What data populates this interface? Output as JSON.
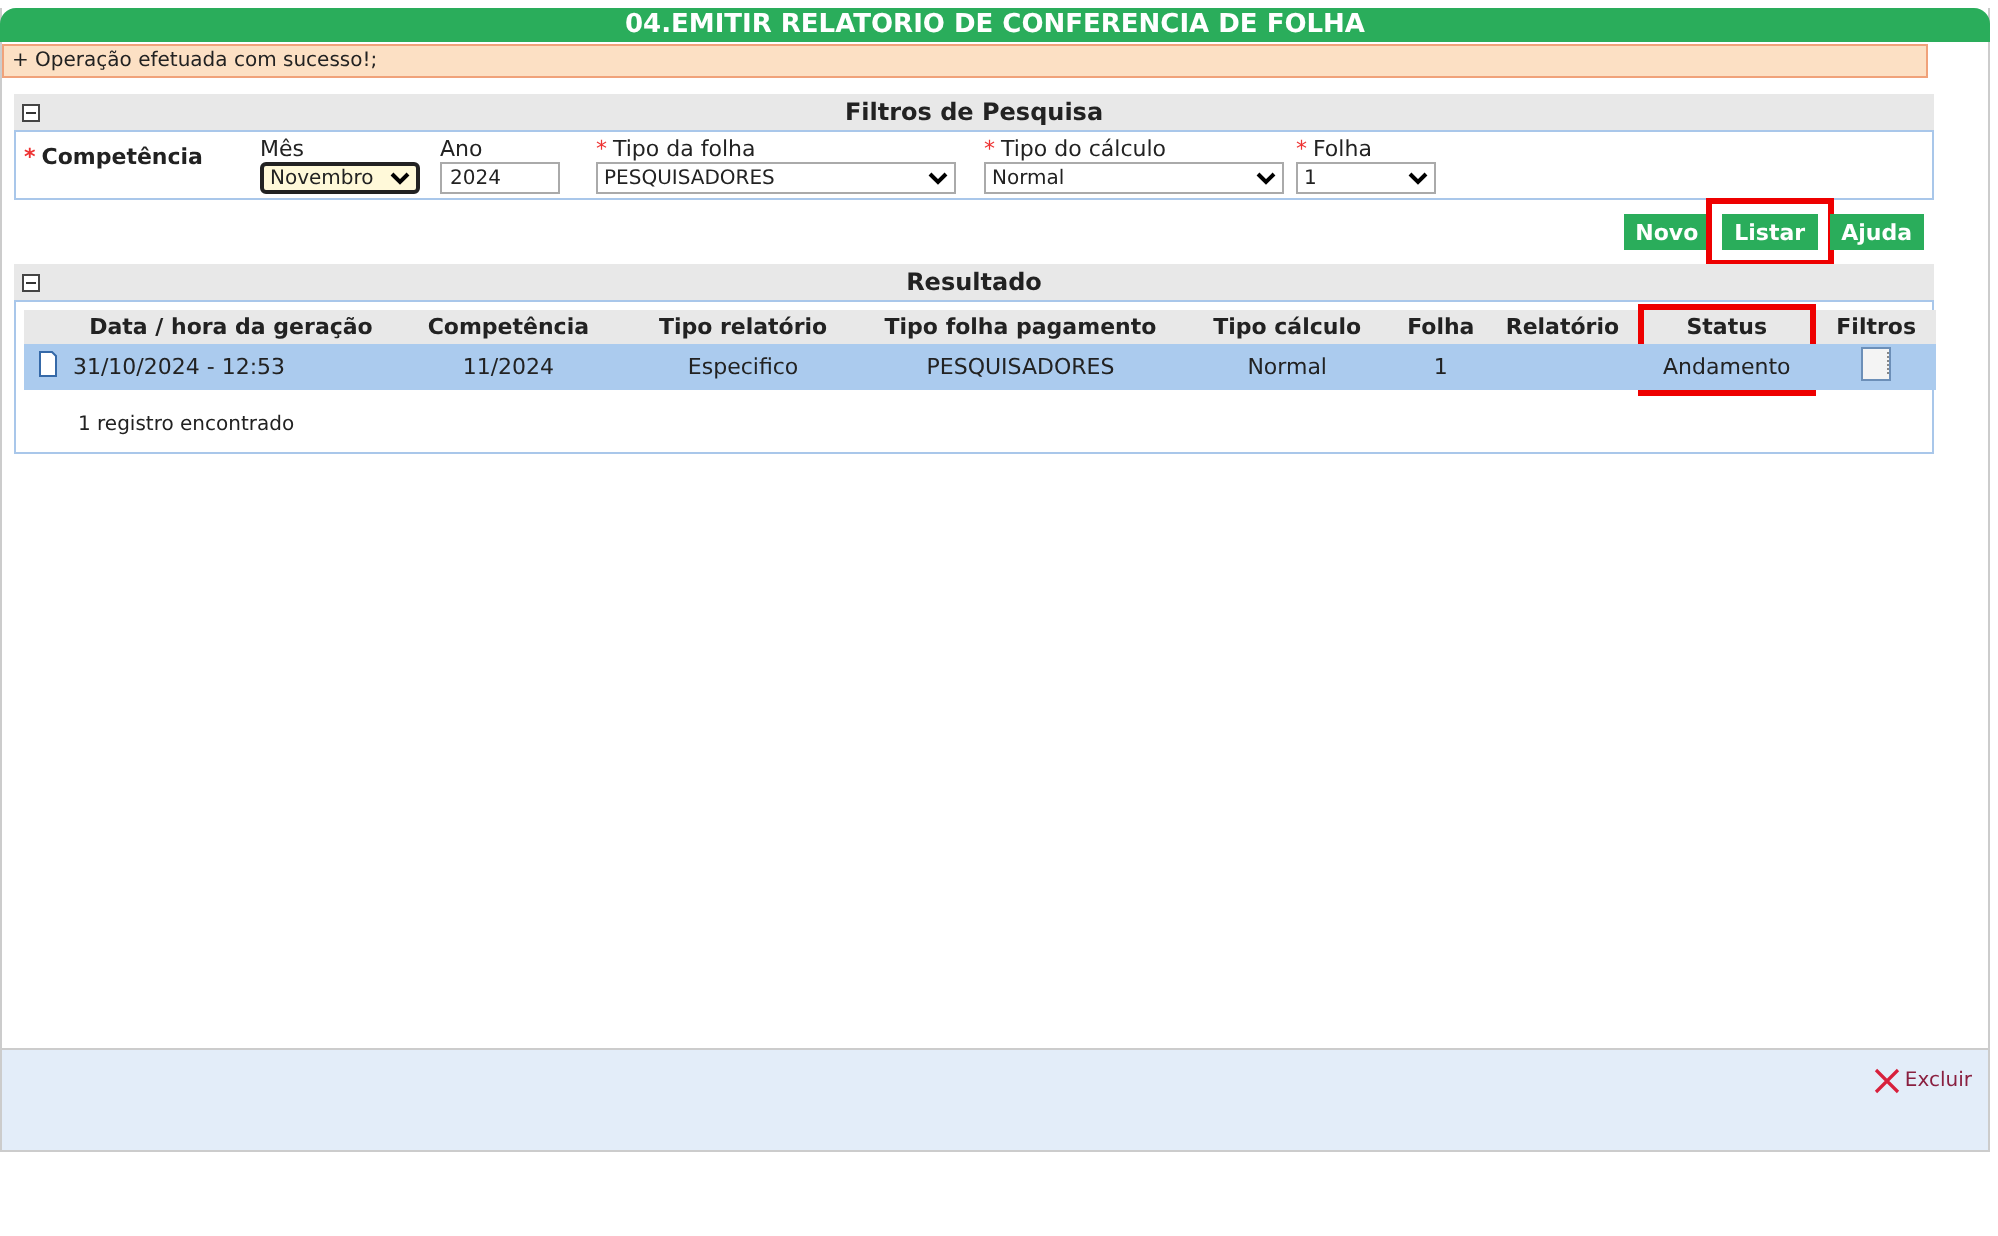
{
  "title": "04.EMITIR RELATORIO DE CONFERENCIA DE FOLHA",
  "message": "+ Operação efetuada com sucesso!;",
  "filters": {
    "title": "Filtros de Pesquisa",
    "expanded": true,
    "competencia_mark": "*",
    "competencia_label": "Competência",
    "fields": [
      {
        "kind": "select",
        "label": "Mês",
        "value": "Novembro",
        "focused": true
      },
      {
        "kind": "input",
        "label": "Ano",
        "value": "2024",
        "focused": false
      },
      {
        "kind": "select",
        "mark": "*",
        "label": "Tipo da folha",
        "value": "PESQUISADORES",
        "focused": false
      },
      {
        "kind": "select",
        "mark": "*",
        "label": "Tipo do cálculo",
        "value": "Normal",
        "focused": false
      },
      {
        "kind": "select",
        "mark": "*",
        "label": "Folha",
        "value": "1",
        "focused": false
      }
    ]
  },
  "buttons": [
    {
      "label": "Novo",
      "highlighted": false
    },
    {
      "label": "Listar",
      "highlighted": true
    },
    {
      "label": "Ajuda",
      "highlighted": false
    }
  ],
  "results": {
    "title": "Resultado",
    "expanded": true,
    "columns": [
      {
        "label": "Data / hora da geração",
        "highlighted": false
      },
      {
        "label": "Competência",
        "highlighted": false
      },
      {
        "label": "Tipo relatório",
        "highlighted": false
      },
      {
        "label": "Tipo folha pagamento",
        "highlighted": false
      },
      {
        "label": "Tipo cálculo",
        "highlighted": false
      },
      {
        "label": "Folha",
        "highlighted": false
      },
      {
        "label": "Relatório",
        "highlighted": false
      },
      {
        "label": "Status",
        "highlighted": true
      },
      {
        "label": "Filtros",
        "highlighted": false
      }
    ],
    "rows": [
      {
        "selected": true,
        "cells": [
          "31/10/2024 - 12:53",
          "11/2024",
          "Especifico",
          "PESQUISADORES",
          "Normal",
          "1",
          "",
          "Andamento"
        ]
      }
    ],
    "count": "1 registro encontrado"
  },
  "footer": {
    "delete_label": "Excluir"
  }
}
